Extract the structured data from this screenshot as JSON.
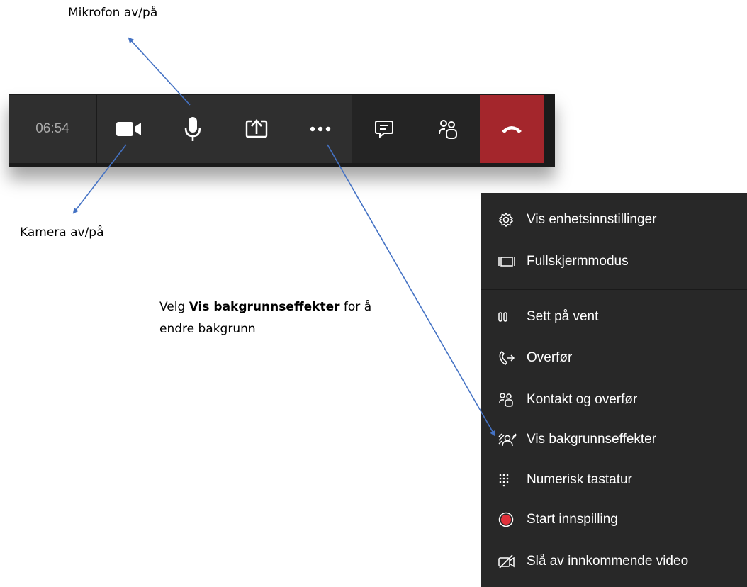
{
  "callouts": {
    "mic": "Mikrofon av/på",
    "camera": "Kamera av/på",
    "instruction_prefix": "Velg ",
    "instruction_bold": "Vis bakgrunnseffekter",
    "instruction_suffix": " for å",
    "instruction_line2": "endre bakgrunn"
  },
  "toolbar": {
    "timer": "06:54",
    "buttons": [
      {
        "icon": "video-camera-icon"
      },
      {
        "icon": "microphone-icon"
      },
      {
        "icon": "share-screen-icon"
      },
      {
        "icon": "more-options-icon"
      },
      {
        "icon": "chat-icon"
      },
      {
        "icon": "participants-icon"
      },
      {
        "icon": "hang-up-icon"
      }
    ],
    "hangup_color": "#a4262c"
  },
  "menu": {
    "items": [
      {
        "label": "Vis enhetsinnstillinger",
        "icon": "gear-icon"
      },
      {
        "label": "Fullskjermmodus",
        "icon": "fullscreen-icon"
      },
      {
        "label": "Sett på vent",
        "icon": "pause-icon"
      },
      {
        "label": "Overfør",
        "icon": "transfer-call-icon"
      },
      {
        "label": "Kontakt og overfør",
        "icon": "consult-transfer-icon"
      },
      {
        "label": "Vis bakgrunnseffekter",
        "icon": "background-effects-icon"
      },
      {
        "label": "Numerisk tastatur",
        "icon": "dialpad-icon"
      },
      {
        "label": "Start innspilling",
        "icon": "record-icon"
      },
      {
        "label": "Slå av innkommende video",
        "icon": "video-off-icon"
      }
    ],
    "record_color": "#e0313b"
  }
}
